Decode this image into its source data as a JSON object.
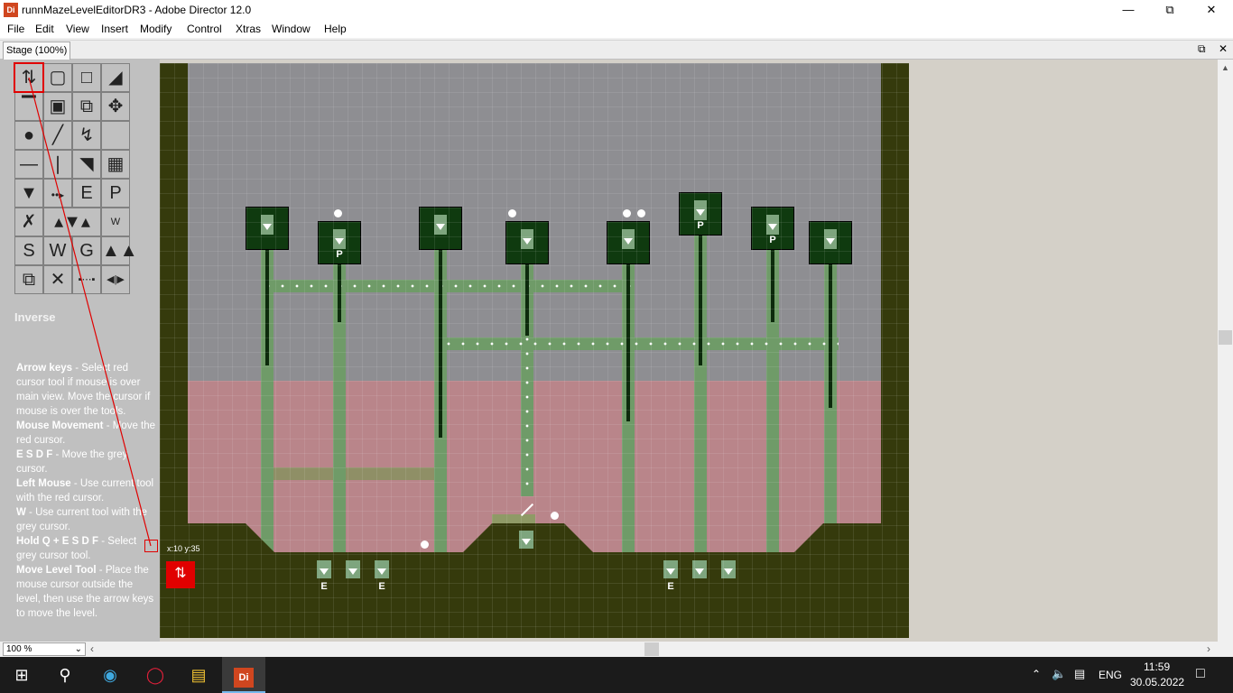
{
  "window": {
    "app_icon": "Di",
    "title": "runnMazeLevelEditorDR3 - Adobe Director 12.0",
    "controls": [
      "minimize-icon",
      "restore-icon",
      "close-icon"
    ]
  },
  "menu": [
    "File",
    "Edit",
    "View",
    "Insert",
    "Modify",
    "Control",
    "Xtras",
    "Window",
    "Help"
  ],
  "stage": {
    "tab_label": "Stage (100%)"
  },
  "tool_panel": {
    "tool_labels": {
      "e": "E",
      "p": "P",
      "w_small": "W",
      "s": "S",
      "w": "W",
      "g": "G"
    },
    "mode_label": "Inverse"
  },
  "help": [
    {
      "key": "Arrow keys",
      "text": " - Select red cursor tool if mouse is over main view. Move the cursor if mouse is over the tools."
    },
    {
      "key": "Mouse Movement",
      "text": " - Move the red cursor."
    },
    {
      "key": "E S D F",
      "text": " - Move the grey cursor."
    },
    {
      "key": "Left Mouse",
      "text": " - Use current tool with the red cursor."
    },
    {
      "key": "W",
      "text": " - Use current tool with the grey cursor."
    },
    {
      "key": "Hold Q + E S D F",
      "text": " - Select grey cursor tool."
    },
    {
      "key": "Move Level Tool",
      "text": " - Place the mouse cursor outside the level, then use the arrow keys to move the level."
    }
  ],
  "level": {
    "coord_readout": "x:10 y:35",
    "box_letters": {
      "b2": "P",
      "b6": "P",
      "b7": "P"
    },
    "bottom_letters": {
      "m1": "E",
      "m3": "E",
      "m4": "E"
    }
  },
  "zoom": "100 %",
  "taskbar": {
    "lang": "ENG",
    "time": "11:59",
    "date": "30.05.2022",
    "app_di": "Di"
  }
}
